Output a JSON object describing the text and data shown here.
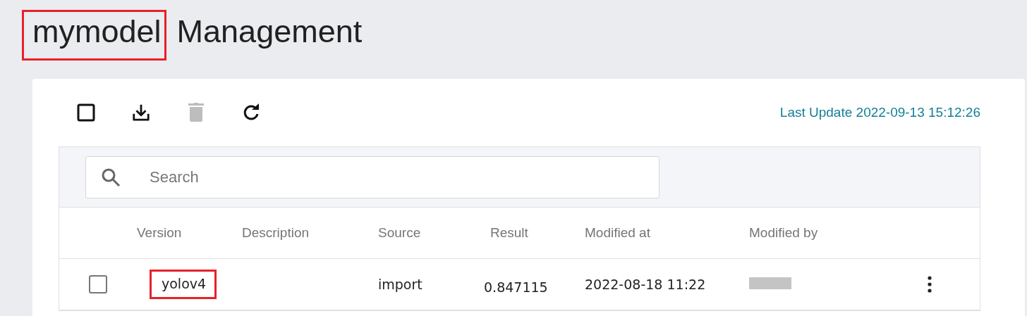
{
  "title": [
    {
      "text": "mymodel",
      "highlighted": true
    },
    {
      "text": "Management",
      "highlighted": false
    }
  ],
  "toolbar": [
    {
      "kind": "select-all",
      "disabled": false
    },
    {
      "kind": "download",
      "disabled": false
    },
    {
      "kind": "delete",
      "disabled": true
    },
    {
      "kind": "refresh",
      "disabled": false
    }
  ],
  "last_update": "Last Update 2022-09-13 15:12:26",
  "search": {
    "placeholder": "Search"
  },
  "table": {
    "columns": [
      "Version",
      "Description",
      "Source",
      "Result",
      "Modified at",
      "Modified by"
    ],
    "rows": [
      {
        "checked": false,
        "version": {
          "text": "yolov4",
          "highlighted": true
        },
        "source": "import",
        "result": "0.847115",
        "modified_at": "2022-08-18 11:22",
        "modified_by_redacted": true
      }
    ]
  }
}
